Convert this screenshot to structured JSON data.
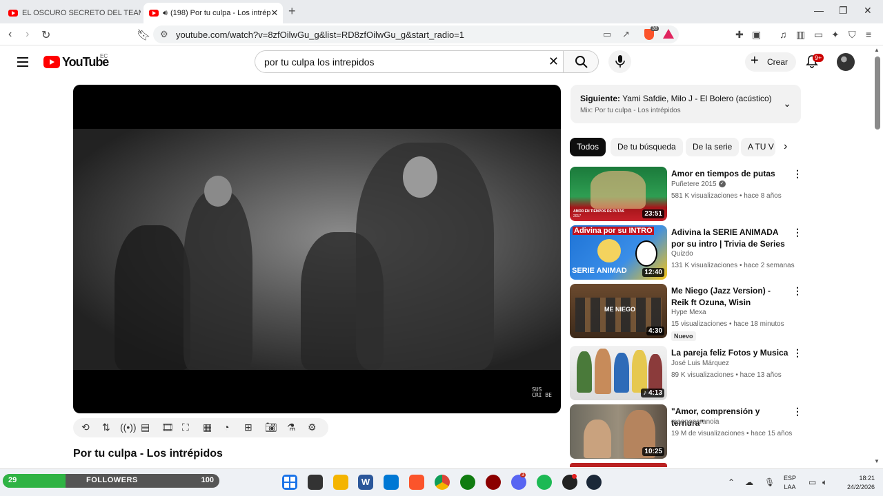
{
  "browser": {
    "tabs": [
      {
        "label": "EL OSCURO SECRETO DEL TEAM RO",
        "active": false
      },
      {
        "label": "(198) Por tu culpa - Los intrép",
        "active": true,
        "audio": true
      }
    ],
    "url": "youtube.com/watch?v=8zfOilwGu_g&list=RD8zfOilwGu_g&start_radio=1",
    "brave_badge": "38"
  },
  "youtube": {
    "logo_text": "YouTube",
    "country_code": "EC",
    "search_value": "por tu culpa los intrepidos",
    "create_label": "Crear",
    "notifications_badge": "9+"
  },
  "player": {
    "watermark": "SUS CRI BE",
    "title": "Por tu culpa - Los intrépidos"
  },
  "mix": {
    "next_prefix": "Siguiente:",
    "next_title": "Yami Safdie, Milo J - El Bolero (acústico)",
    "subtitle": "Mix: Por tu culpa - Los intrépidos"
  },
  "chips": [
    "Todos",
    "De tu búsqueda",
    "De la serie",
    "A TU V"
  ],
  "recommendations": [
    {
      "title": "Amor en tiempos de putas",
      "channel": "Puñetere 2015",
      "verified": true,
      "views": "581 K visualizaciones",
      "age": "hace 8 años",
      "duration": "23:51",
      "thumb_text": "AMOR EN TIEMPOS DE PUTAS",
      "thumb_subtext": "2017"
    },
    {
      "title": "Adivina la SERIE ANIMADA por su intro | Trivia de Series",
      "channel": "Quizdo",
      "views": "131 K visualizaciones",
      "age": "hace 2 semanas",
      "duration": "12:40",
      "thumb_text": "Adivina por su INTRO",
      "thumb_bottom": "SERIE ANIMAD"
    },
    {
      "title": "Me Niego (Jazz Version) - Reik ft  Ozuna, Wisin",
      "channel": "Hype Mexa",
      "views": "15 visualizaciones",
      "age": "hace 18 minutos",
      "duration": "4:30",
      "badge": "Nuevo",
      "thumb_text": "ME NIEGO"
    },
    {
      "title": "La pareja feliz Fotos y Musica",
      "channel": "José Luis Márquez",
      "views": "89 K visualizaciones",
      "age": "hace 13 años",
      "duration": "4:13"
    },
    {
      "title": "\"Amor, comprensión y ternura\"",
      "channel": "magnoparanoia",
      "views": "19 M de visualizaciones",
      "age": "hace 15 años",
      "duration": "10:25"
    }
  ],
  "taskbar": {
    "followers_current": "29",
    "followers_label": "FOLLOWERS",
    "followers_goal": "100",
    "followers_fraction": 0.29,
    "lang_top": "ESP",
    "lang_bottom": "LAA",
    "time": "18:21",
    "date": "24/2/2026",
    "discord_badge": "3"
  }
}
